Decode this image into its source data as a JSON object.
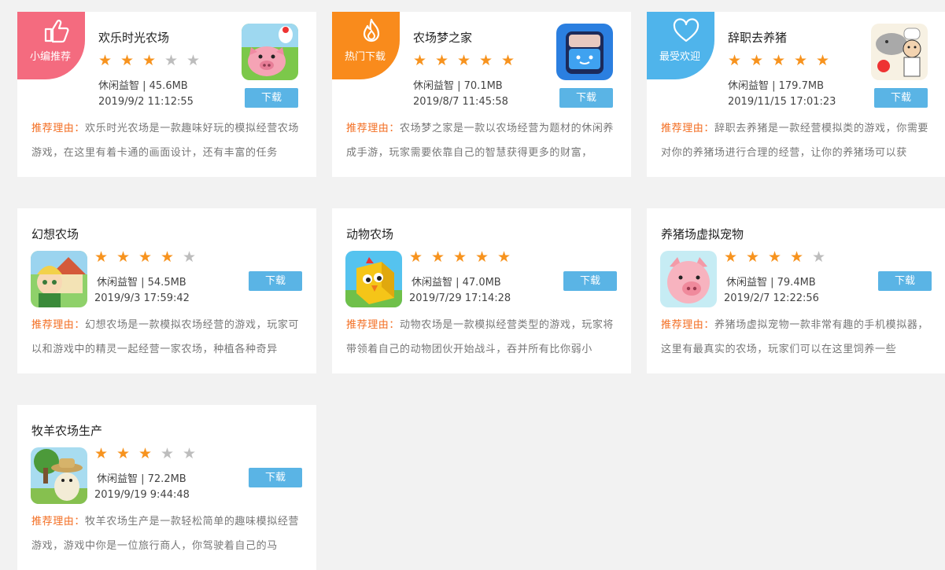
{
  "reason_label": "推荐理由：",
  "download_label": "下载",
  "colors": {
    "accent_blue": "#5ab4e5",
    "star": "#f7931e",
    "reason_label": "#f36d21"
  },
  "featured": [
    {
      "badge": "小编推荐",
      "badge_icon": "thumbs-up-icon",
      "title": "欢乐时光农场",
      "rating": 3,
      "meta": "休闲益智 | 45.6MB",
      "date": "2019/9/2 11:12:55",
      "reason": "欢乐时光农场是一款趣味好玩的模拟经营农场游戏，在这里有着卡通的画面设计，还有丰富的任务"
    },
    {
      "badge": "热门下载",
      "badge_icon": "flame-icon",
      "title": "农场梦之家",
      "rating": 5,
      "meta": "休闲益智 | 70.1MB",
      "date": "2019/8/7 11:45:58",
      "reason": "农场梦之家是一款以农场经营为题材的休闲养成手游，玩家需要依靠自己的智慧获得更多的财富，"
    },
    {
      "badge": "最受欢迎",
      "badge_icon": "heart-icon",
      "title": "辞职去养猪",
      "rating": 5,
      "meta": "休闲益智 | 179.7MB",
      "date": "2019/11/15 17:01:23",
      "reason": "辞职去养猪是一款经营模拟类的游戏，你需要对你的养猪场进行合理的经营，让你的养猪场可以获"
    }
  ],
  "games": [
    {
      "title": "幻想农场",
      "rating": 4,
      "meta": "休闲益智 | 54.5MB",
      "date": "2019/9/3 17:59:42",
      "reason": "幻想农场是一款模拟农场经营的游戏，玩家可以和游戏中的精灵一起经营一家农场，种植各种奇异"
    },
    {
      "title": "动物农场",
      "rating": 5,
      "meta": "休闲益智 | 47.0MB",
      "date": "2019/7/29 17:14:28",
      "reason": "动物农场是一款模拟经营类型的游戏，玩家将带领着自己的动物团伙开始战斗，吞并所有比你弱小"
    },
    {
      "title": "养猪场虚拟宠物",
      "rating": 4,
      "meta": "休闲益智 | 79.4MB",
      "date": "2019/2/7 12:22:56",
      "reason": "养猪场虚拟宠物一款非常有趣的手机模拟器，这里有最真实的农场，玩家们可以在这里饲养一些"
    },
    {
      "title": "牧羊农场生产",
      "rating": 3,
      "meta": "休闲益智 | 72.2MB",
      "date": "2019/9/19 9:44:48",
      "reason": "牧羊农场生产是一款轻松简单的趣味模拟经营游戏，游戏中你是一位旅行商人，你驾驶着自己的马"
    }
  ]
}
